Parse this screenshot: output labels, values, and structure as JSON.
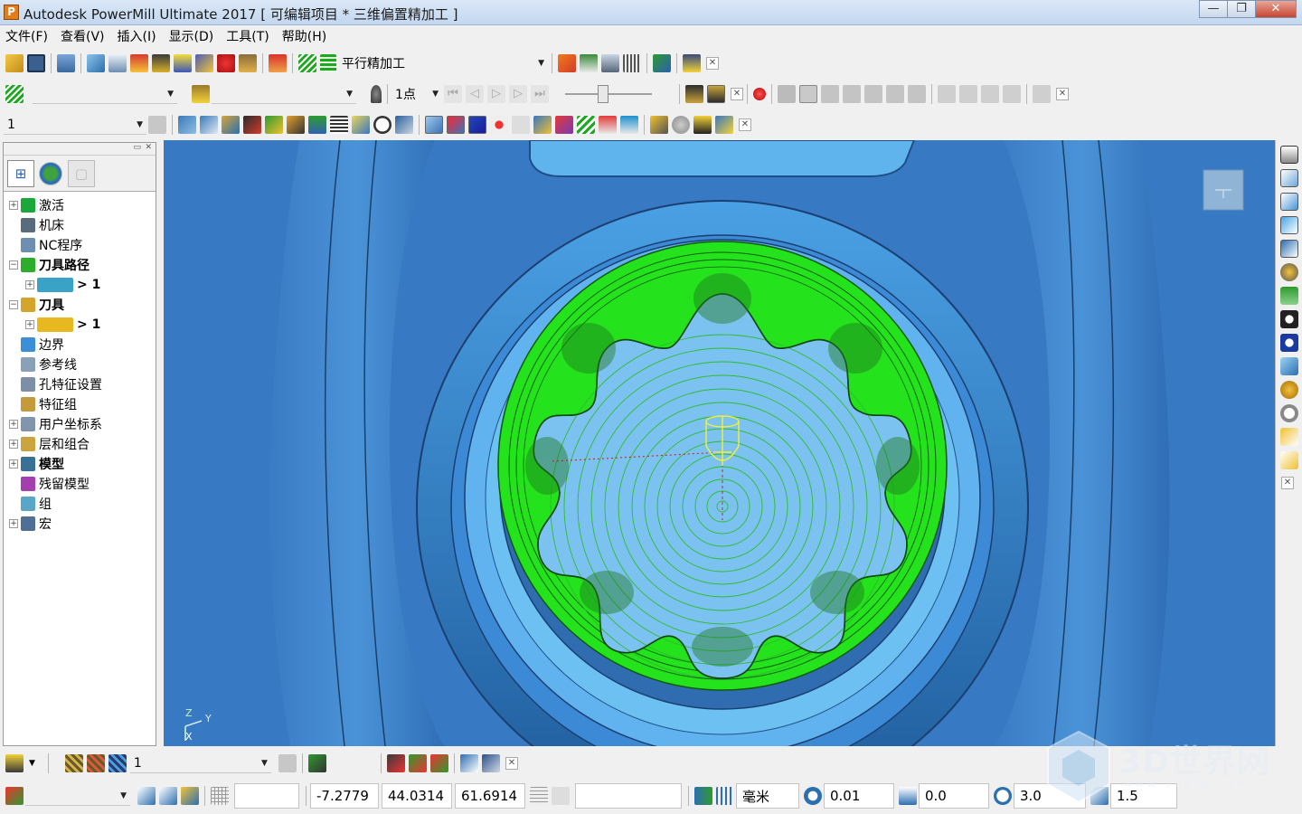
{
  "window": {
    "title": "Autodesk PowerMill Ultimate 2017   [ 可编辑项目 * 三维偏置精加工 ]",
    "app_icon_letter": "P",
    "minimize": "—",
    "maximize": "❐",
    "close": "✕"
  },
  "menu": [
    "文件(F)",
    "查看(V)",
    "插入(I)",
    "显示(D)",
    "工具(T)",
    "帮助(H)"
  ],
  "toolbar1": {
    "toolpath_strategy": "平行精加工"
  },
  "toolbar2": {
    "dropdown1": "",
    "dropdown2": "",
    "point_mode": "1点"
  },
  "toolbar3": {
    "layer_select": "1"
  },
  "tree": {
    "items": [
      {
        "label": "激活",
        "bold": false,
        "expander": "+",
        "icon_color": "#1aa83a"
      },
      {
        "label": "机床",
        "bold": false,
        "expander": "",
        "icon_color": "#5a6b7d"
      },
      {
        "label": "NC程序",
        "bold": false,
        "expander": "",
        "icon_color": "#6d8fb0"
      },
      {
        "label": "刀具路径",
        "bold": true,
        "expander": "−",
        "icon_color": "#2cae2c"
      },
      {
        "label": "> 1",
        "bold": true,
        "expander": "+",
        "icon_color": "#3aa2c7",
        "sub": true
      },
      {
        "label": "刀具",
        "bold": true,
        "expander": "−",
        "icon_color": "#d4a52a"
      },
      {
        "label": "> 1",
        "bold": true,
        "expander": "+",
        "icon_color": "#e7b820",
        "sub": true
      },
      {
        "label": "边界",
        "bold": false,
        "expander": "",
        "icon_color": "#3b8fd6"
      },
      {
        "label": "参考线",
        "bold": false,
        "expander": "",
        "icon_color": "#8aa0b6"
      },
      {
        "label": "孔特征设置",
        "bold": false,
        "expander": "",
        "icon_color": "#7c8fa6"
      },
      {
        "label": "特征组",
        "bold": false,
        "expander": "",
        "icon_color": "#c49a3a"
      },
      {
        "label": "用户坐标系",
        "bold": false,
        "expander": "+",
        "icon_color": "#8195ad"
      },
      {
        "label": "层和组合",
        "bold": false,
        "expander": "+",
        "icon_color": "#caa53e"
      },
      {
        "label": "模型",
        "bold": true,
        "expander": "+",
        "icon_color": "#3a6f96"
      },
      {
        "label": "残留模型",
        "bold": false,
        "expander": "",
        "icon_color": "#a43fb0"
      },
      {
        "label": "组",
        "bold": false,
        "expander": "",
        "icon_color": "#59a6c9"
      },
      {
        "label": "宏",
        "bold": false,
        "expander": "+",
        "icon_color": "#4f6f94"
      }
    ]
  },
  "axes": {
    "z": "Z",
    "y": "Y",
    "x": "X"
  },
  "view_cube_label": "",
  "bottom_toolbar1": {
    "layer_value": "1"
  },
  "status": {
    "workplane": "",
    "coord_x": "-7.2779",
    "coord_y": "44.0314",
    "coord_z": "61.6914",
    "info": "",
    "units": "毫米",
    "tolerance": "0.01",
    "stock": "0.0",
    "diameter": "3.0",
    "stepover": "1.5"
  },
  "watermark": {
    "brand": "3D世界网",
    "url": "www.3dsjw.com"
  },
  "colors": {
    "viewport_bg": "#3a79c2",
    "toolpath_green": "#22e11b",
    "part_blue": "#62b8ef",
    "tool_yellow": "#f2f03a"
  }
}
